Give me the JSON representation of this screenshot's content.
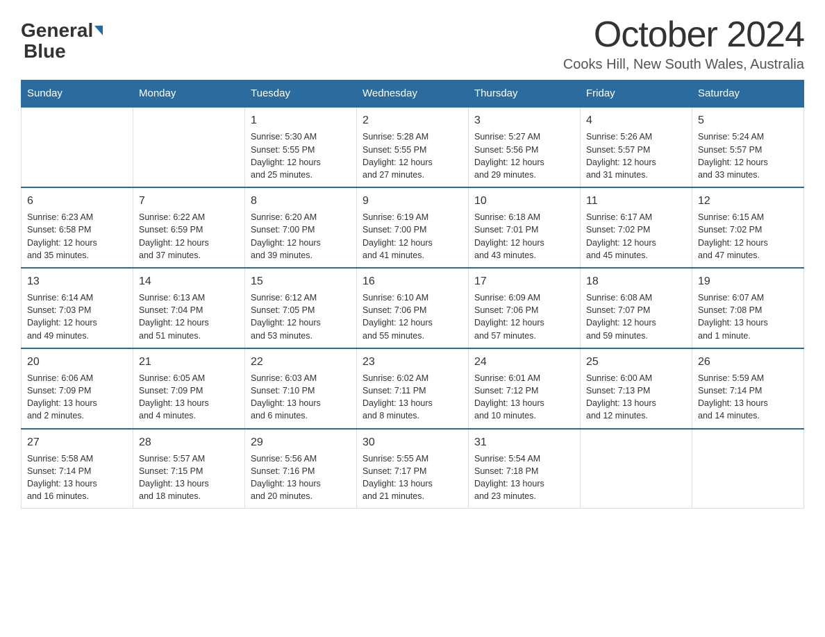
{
  "header": {
    "logo_general": "General",
    "logo_blue": "Blue",
    "title": "October 2024",
    "subtitle": "Cooks Hill, New South Wales, Australia"
  },
  "days_of_week": [
    "Sunday",
    "Monday",
    "Tuesday",
    "Wednesday",
    "Thursday",
    "Friday",
    "Saturday"
  ],
  "weeks": [
    [
      {
        "day": "",
        "info": ""
      },
      {
        "day": "",
        "info": ""
      },
      {
        "day": "1",
        "info": "Sunrise: 5:30 AM\nSunset: 5:55 PM\nDaylight: 12 hours\nand 25 minutes."
      },
      {
        "day": "2",
        "info": "Sunrise: 5:28 AM\nSunset: 5:55 PM\nDaylight: 12 hours\nand 27 minutes."
      },
      {
        "day": "3",
        "info": "Sunrise: 5:27 AM\nSunset: 5:56 PM\nDaylight: 12 hours\nand 29 minutes."
      },
      {
        "day": "4",
        "info": "Sunrise: 5:26 AM\nSunset: 5:57 PM\nDaylight: 12 hours\nand 31 minutes."
      },
      {
        "day": "5",
        "info": "Sunrise: 5:24 AM\nSunset: 5:57 PM\nDaylight: 12 hours\nand 33 minutes."
      }
    ],
    [
      {
        "day": "6",
        "info": "Sunrise: 6:23 AM\nSunset: 6:58 PM\nDaylight: 12 hours\nand 35 minutes."
      },
      {
        "day": "7",
        "info": "Sunrise: 6:22 AM\nSunset: 6:59 PM\nDaylight: 12 hours\nand 37 minutes."
      },
      {
        "day": "8",
        "info": "Sunrise: 6:20 AM\nSunset: 7:00 PM\nDaylight: 12 hours\nand 39 minutes."
      },
      {
        "day": "9",
        "info": "Sunrise: 6:19 AM\nSunset: 7:00 PM\nDaylight: 12 hours\nand 41 minutes."
      },
      {
        "day": "10",
        "info": "Sunrise: 6:18 AM\nSunset: 7:01 PM\nDaylight: 12 hours\nand 43 minutes."
      },
      {
        "day": "11",
        "info": "Sunrise: 6:17 AM\nSunset: 7:02 PM\nDaylight: 12 hours\nand 45 minutes."
      },
      {
        "day": "12",
        "info": "Sunrise: 6:15 AM\nSunset: 7:02 PM\nDaylight: 12 hours\nand 47 minutes."
      }
    ],
    [
      {
        "day": "13",
        "info": "Sunrise: 6:14 AM\nSunset: 7:03 PM\nDaylight: 12 hours\nand 49 minutes."
      },
      {
        "day": "14",
        "info": "Sunrise: 6:13 AM\nSunset: 7:04 PM\nDaylight: 12 hours\nand 51 minutes."
      },
      {
        "day": "15",
        "info": "Sunrise: 6:12 AM\nSunset: 7:05 PM\nDaylight: 12 hours\nand 53 minutes."
      },
      {
        "day": "16",
        "info": "Sunrise: 6:10 AM\nSunset: 7:06 PM\nDaylight: 12 hours\nand 55 minutes."
      },
      {
        "day": "17",
        "info": "Sunrise: 6:09 AM\nSunset: 7:06 PM\nDaylight: 12 hours\nand 57 minutes."
      },
      {
        "day": "18",
        "info": "Sunrise: 6:08 AM\nSunset: 7:07 PM\nDaylight: 12 hours\nand 59 minutes."
      },
      {
        "day": "19",
        "info": "Sunrise: 6:07 AM\nSunset: 7:08 PM\nDaylight: 13 hours\nand 1 minute."
      }
    ],
    [
      {
        "day": "20",
        "info": "Sunrise: 6:06 AM\nSunset: 7:09 PM\nDaylight: 13 hours\nand 2 minutes."
      },
      {
        "day": "21",
        "info": "Sunrise: 6:05 AM\nSunset: 7:09 PM\nDaylight: 13 hours\nand 4 minutes."
      },
      {
        "day": "22",
        "info": "Sunrise: 6:03 AM\nSunset: 7:10 PM\nDaylight: 13 hours\nand 6 minutes."
      },
      {
        "day": "23",
        "info": "Sunrise: 6:02 AM\nSunset: 7:11 PM\nDaylight: 13 hours\nand 8 minutes."
      },
      {
        "day": "24",
        "info": "Sunrise: 6:01 AM\nSunset: 7:12 PM\nDaylight: 13 hours\nand 10 minutes."
      },
      {
        "day": "25",
        "info": "Sunrise: 6:00 AM\nSunset: 7:13 PM\nDaylight: 13 hours\nand 12 minutes."
      },
      {
        "day": "26",
        "info": "Sunrise: 5:59 AM\nSunset: 7:14 PM\nDaylight: 13 hours\nand 14 minutes."
      }
    ],
    [
      {
        "day": "27",
        "info": "Sunrise: 5:58 AM\nSunset: 7:14 PM\nDaylight: 13 hours\nand 16 minutes."
      },
      {
        "day": "28",
        "info": "Sunrise: 5:57 AM\nSunset: 7:15 PM\nDaylight: 13 hours\nand 18 minutes."
      },
      {
        "day": "29",
        "info": "Sunrise: 5:56 AM\nSunset: 7:16 PM\nDaylight: 13 hours\nand 20 minutes."
      },
      {
        "day": "30",
        "info": "Sunrise: 5:55 AM\nSunset: 7:17 PM\nDaylight: 13 hours\nand 21 minutes."
      },
      {
        "day": "31",
        "info": "Sunrise: 5:54 AM\nSunset: 7:18 PM\nDaylight: 13 hours\nand 23 minutes."
      },
      {
        "day": "",
        "info": ""
      },
      {
        "day": "",
        "info": ""
      }
    ]
  ]
}
